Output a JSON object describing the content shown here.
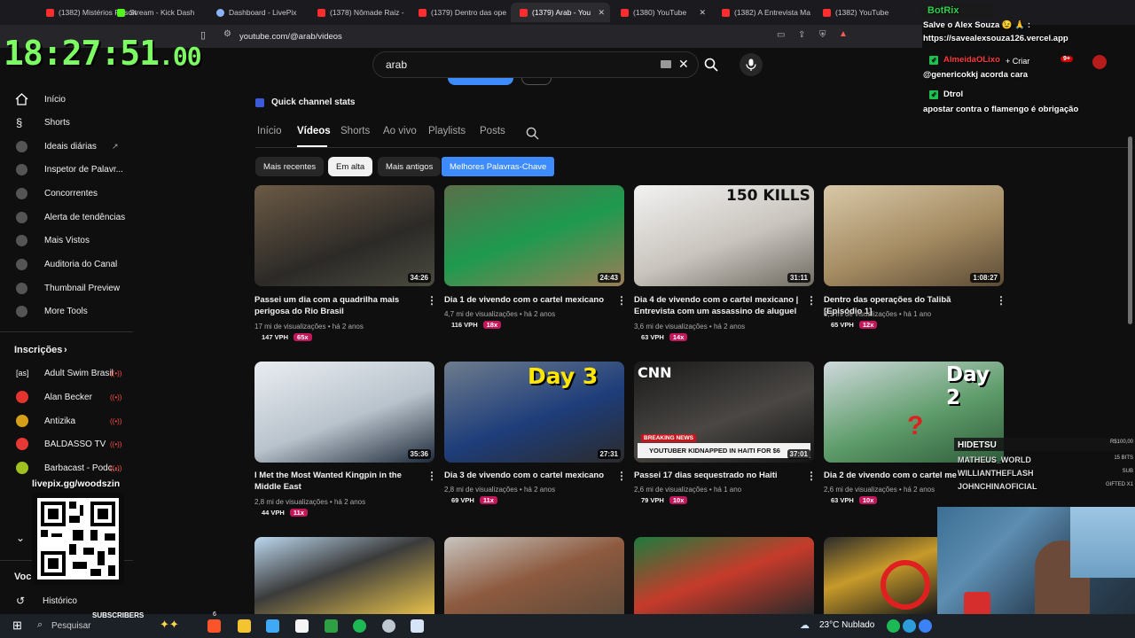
{
  "browser": {
    "tabs": [
      {
        "label": "(1382) Mistérios Resolv",
        "icon": "youtube"
      },
      {
        "label": "Stream - Kick Dash",
        "icon": "kick"
      },
      {
        "label": "Dashboard - LivePix",
        "icon": "livepix"
      },
      {
        "label": "(1378) Nômade Raiz -",
        "icon": "youtube"
      },
      {
        "label": "(1379) Dentro das ope",
        "icon": "youtube"
      },
      {
        "label": "(1379) Arab - You",
        "icon": "youtube",
        "active": true
      },
      {
        "label": "(1380) YouTube",
        "icon": "youtube"
      },
      {
        "label": "(1382) A Entrevista Ma",
        "icon": "youtube"
      },
      {
        "label": "(1382) YouTube",
        "icon": "youtube"
      }
    ],
    "url": "youtube.com/@arab/videos"
  },
  "clock": {
    "main": "18:27:51",
    "fraction": ".00"
  },
  "search": {
    "value": "arab"
  },
  "header": {
    "create_label": "Criar",
    "notif_badge": "9+"
  },
  "sidebar": {
    "items": [
      {
        "label": "Início"
      },
      {
        "label": "Shorts"
      },
      {
        "label": "Ideais diárias"
      },
      {
        "label": "Inspetor de Palavr..."
      },
      {
        "label": "Concorrentes"
      },
      {
        "label": "Alerta de tendências"
      },
      {
        "label": "Mais Vistos"
      },
      {
        "label": "Auditoria do Canal"
      },
      {
        "label": "Thumbnail Preview"
      },
      {
        "label": "More Tools"
      }
    ],
    "subs_heading": "Inscrições",
    "channels": [
      {
        "label": "Adult Swim Brasil"
      },
      {
        "label": "Alan Becker"
      },
      {
        "label": "Antizika"
      },
      {
        "label": "BALDASSO TV"
      },
      {
        "label": "Barbacast - Podc..."
      }
    ],
    "section_label": "Voc",
    "history_label": "Histórico"
  },
  "channel": {
    "quick_stats": "Quick channel stats",
    "nav_tabs": [
      "Início",
      "Vídeos",
      "Shorts",
      "Ao vivo",
      "Playlists",
      "Posts"
    ],
    "chips": [
      "Mais recentes",
      "Em alta",
      "Mais antigos",
      "Melhores Palavras-Chave"
    ]
  },
  "videos": [
    {
      "title": "Passei um dia com a quadrilha mais perigosa do Rio Brasil",
      "meta": "17 mi de visualizações • há 2 anos",
      "vph": "147 VPH",
      "mult": "65x",
      "duration": "34:26"
    },
    {
      "title": "Dia 1 de vivendo com o cartel mexicano",
      "meta": "4,7 mi de visualizações • há 2 anos",
      "vph": "116 VPH",
      "mult": "18x",
      "duration": "24:43"
    },
    {
      "title": "Dia 4 de vivendo com o cartel mexicano | Entrevista com um assassino de aluguel",
      "meta": "3,6 mi de visualizações • há 2 anos",
      "vph": "63 VPH",
      "mult": "14x",
      "duration": "31:11",
      "overlay": "150 KILLS"
    },
    {
      "title": "Dentro das operações do Talibã [Episódio 1]",
      "meta": "3,1 mi de visualizações • há 1 ano",
      "vph": "65 VPH",
      "mult": "12x",
      "duration": "1:08:27"
    },
    {
      "title": "I Met the Most Wanted Kingpin in the Middle East",
      "meta": "2,8 mi de visualizações • há 2 anos",
      "vph": "44 VPH",
      "mult": "11x",
      "duration": "35:36"
    },
    {
      "title": "Dia 3 de vivendo com o cartel mexicano",
      "meta": "2,8 mi de visualizações • há 2 anos",
      "vph": "69 VPH",
      "mult": "11x",
      "duration": "27:31",
      "overlay": "Day 3"
    },
    {
      "title": "Passei 17 dias sequestrado no Haiti",
      "meta": "2,6 mi de visualizações • há 1 ano",
      "vph": "79 VPH",
      "mult": "10x",
      "duration": "37:01",
      "overlay": "CNN",
      "banner": "BREAKING NEWS",
      "caption": "YOUTUBER KIDNAPPED IN HAITI FOR $6"
    },
    {
      "title": "Dia 2 de vivendo com o cartel mexic",
      "meta": "2,6 mi de visualizações • há 2 anos",
      "vph": "63 VPH",
      "mult": "10x",
      "overlay": "Day 2"
    }
  ],
  "chat": [
    {
      "name": "BotRix",
      "color": "#2bd14a",
      "text": "Salve o Alex Souza 😉 🙏 :",
      "text2": "https://savealexsouza126.vercel.app"
    },
    {
      "name": "AlmeidaOLixo",
      "color": "#ff3b3b",
      "text": "@genericokkj acorda cara"
    },
    {
      "name": "Dtrol",
      "color": "#ffffff",
      "text": "apostar contra o flamengo é obrigação"
    }
  ],
  "subs_panel": [
    {
      "name": "HIDETSU",
      "value": "R$100,00"
    },
    {
      "name": "MATHEUS_WORLD",
      "value": "15 BITS"
    },
    {
      "name": "WILLIANTHEFLASH",
      "value": "SUB"
    },
    {
      "name": "JOHNCHINAOFICIAL",
      "value": "GIFTED X1"
    }
  ],
  "qr": {
    "label": "livepix.gg/woodszin"
  },
  "subs_bar": {
    "label": "SUBSCRIBERS",
    "count": "6"
  },
  "taskbar": {
    "search": "Pesquisar",
    "weather": "23°C Nublado"
  },
  "colors": {
    "accent": "#3d8bfd",
    "clock": "#7cfc62",
    "badge": "#c2185b"
  }
}
